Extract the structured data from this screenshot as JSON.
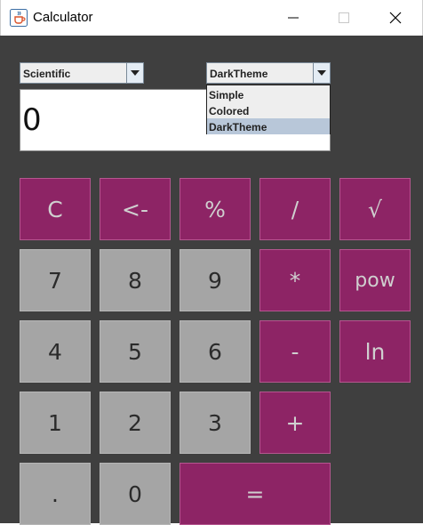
{
  "window": {
    "title": "Calculator"
  },
  "mode_select": {
    "selected": "Scientific"
  },
  "theme_select": {
    "selected": "DarkTheme",
    "options": [
      "Simple",
      "Colored",
      "DarkTheme"
    ]
  },
  "display": {
    "value": "0"
  },
  "keys": {
    "clear": "C",
    "backspace": "<-",
    "percent": "%",
    "divide": "/",
    "sqrt": "√",
    "seven": "7",
    "eight": "8",
    "nine": "9",
    "multiply": "*",
    "pow": "pow",
    "four": "4",
    "five": "5",
    "six": "6",
    "subtract": "-",
    "ln": "ln",
    "one": "1",
    "two": "2",
    "three": "3",
    "add": "+",
    "decimal": ".",
    "zero": "0",
    "equals": "="
  },
  "colors": {
    "background": "#3f3f3f",
    "operator_key": "#8d2465",
    "number_key": "#a5a5a5",
    "selected_option": "#b8c7d9"
  }
}
